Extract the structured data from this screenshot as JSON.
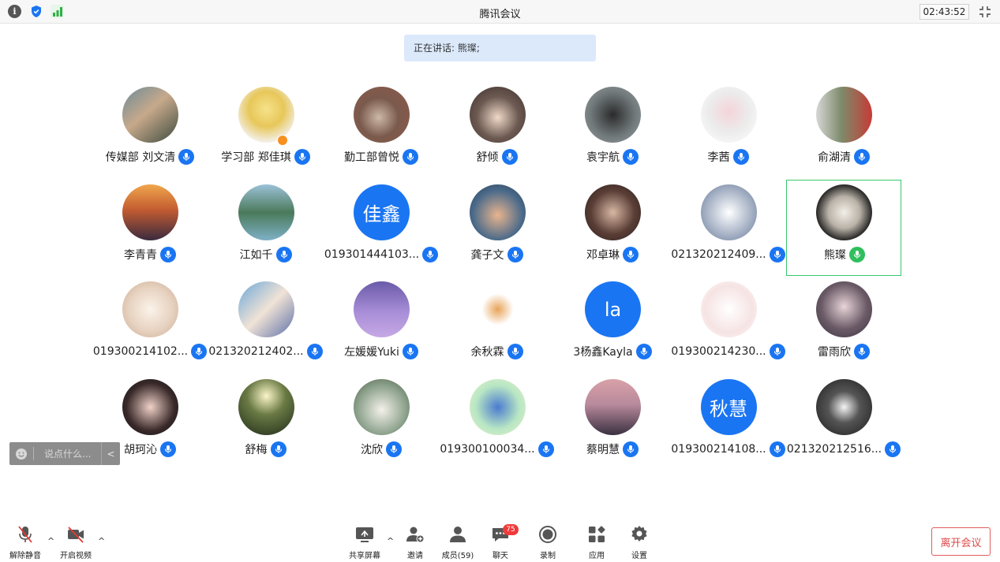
{
  "title": "腾讯会议",
  "clock": "02:43:52",
  "speaking_text": "正在讲话: 熊璨;",
  "colors": {
    "accent": "#1a75f2",
    "active_speaker": "#2fbf5c",
    "leave": "#e04848",
    "chat_badge": "#f03a3a"
  },
  "participants": [
    {
      "name": "传媒部 刘文清",
      "avatar": "photo"
    },
    {
      "name": "学习部 郑佳琪",
      "avatar": "photo",
      "host": true
    },
    {
      "name": "勤工部曾悦",
      "avatar": "photo"
    },
    {
      "name": "舒倾",
      "avatar": "photo"
    },
    {
      "name": "袁宇航",
      "avatar": "photo"
    },
    {
      "name": "李茜",
      "avatar": "photo"
    },
    {
      "name": "俞湖清",
      "avatar": "photo"
    },
    {
      "name": "李青青",
      "avatar": "photo"
    },
    {
      "name": "江如千",
      "avatar": "photo"
    },
    {
      "name": "019301444103...",
      "avatar_text": "佳鑫"
    },
    {
      "name": "龚子文",
      "avatar": "photo"
    },
    {
      "name": "邓卓琳",
      "avatar": "photo"
    },
    {
      "name": "021320212409...",
      "avatar": "photo"
    },
    {
      "name": "熊璨",
      "avatar": "photo",
      "speaking": true
    },
    {
      "name": "019300214102...",
      "avatar": "photo"
    },
    {
      "name": "021320212402...",
      "avatar": "photo"
    },
    {
      "name": "左媛媛Yuki",
      "avatar": "photo"
    },
    {
      "name": "余秋霖",
      "avatar": "photo"
    },
    {
      "name": "3杨鑫Kayla",
      "avatar_text": "la"
    },
    {
      "name": "019300214230...",
      "avatar": "photo"
    },
    {
      "name": "雷雨欣",
      "avatar": "photo"
    },
    {
      "name": "胡珂沁",
      "avatar": "photo"
    },
    {
      "name": "舒梅",
      "avatar": "photo"
    },
    {
      "name": "沈欣",
      "avatar": "photo"
    },
    {
      "name": "019300100034...",
      "avatar": "photo"
    },
    {
      "name": "蔡明慧",
      "avatar": "photo"
    },
    {
      "name": "019300214108...",
      "avatar_text": "秋慧"
    },
    {
      "name": "021320212516...",
      "avatar": "photo"
    }
  ],
  "chat_placeholder": "说点什么...",
  "toolbar": {
    "unmute": "解除静音",
    "start_video": "开启视频",
    "share_screen": "共享屏幕",
    "invite": "邀请",
    "members": "成员(59)",
    "chat": "聊天",
    "chat_badge": "75",
    "record": "录制",
    "apps": "应用",
    "settings": "设置",
    "leave": "离开会议"
  }
}
